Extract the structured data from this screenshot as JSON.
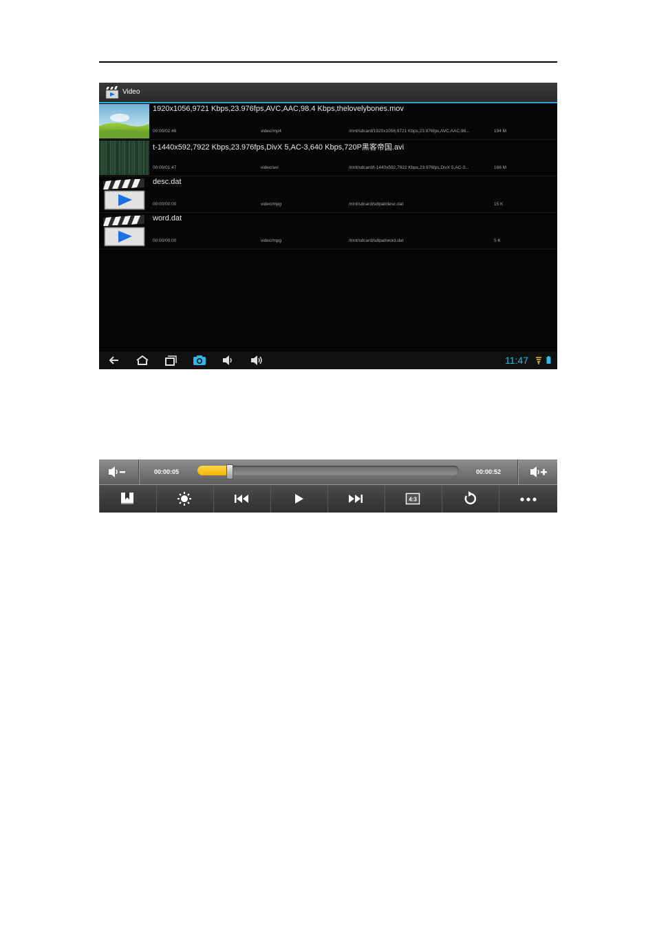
{
  "app": {
    "title": "Video",
    "accent_color": "#33b5e5"
  },
  "videos": [
    {
      "title": "1920x1056,9721 Kbps,23.976fps,AVC,AAC,98.4 Kbps,thelovelybones.mov",
      "duration": "00:00/02:46",
      "mime": "video/mp4",
      "path": "/mnt/sdcard/1920x1056,9721 Kbps,23.976fps,AVC,AAC,98...",
      "size": "194 M",
      "thumbnail": "landscape-thumbnail"
    },
    {
      "title": "t-1440x592,7922 Kbps,23.976fps,DivX 5,AC-3,640 Kbps,720P黑客帝国.avi",
      "duration": "00:00/01:47",
      "mime": "video/avi",
      "path": "/mnt/sdcard/t-1440x592,7922 Kbps,23.976fps,DivX 5,AC-3...",
      "size": "166 M",
      "thumbnail": "matrix-thumbnail"
    },
    {
      "title": "desc.dat",
      "duration": "00:00/00:00",
      "mime": "video/mpg",
      "path": "/mnt/sdcard/sdlpal/desc.dat",
      "size": "15 K",
      "thumbnail": "clapperboard-icon"
    },
    {
      "title": "word.dat",
      "duration": "00:00/00:00",
      "mime": "video/mpg",
      "path": "/mnt/sdcard/sdlpal/word.dat",
      "size": "5 K",
      "thumbnail": "clapperboard-icon"
    }
  ],
  "navbar": {
    "buttons": [
      "back-icon",
      "home-icon",
      "recent-apps-icon",
      "screenshot-icon",
      "volume-down-icon",
      "volume-up-icon"
    ],
    "clock": "11:47",
    "status_icons": [
      "signal-icon",
      "battery-icon"
    ]
  },
  "player": {
    "current_time": "00:00:05",
    "total_time": "00:00:52",
    "progress_fraction": 0.12,
    "progress_color": "#f5b800",
    "top_buttons": [
      "volume-minus-icon",
      "volume-plus-icon"
    ],
    "controls": [
      "bookmark-icon",
      "brightness-icon",
      "previous-icon",
      "play-icon",
      "next-icon",
      "aspect-ratio-icon",
      "repeat-icon",
      "more-icon"
    ],
    "aspect_label": "4:3"
  }
}
